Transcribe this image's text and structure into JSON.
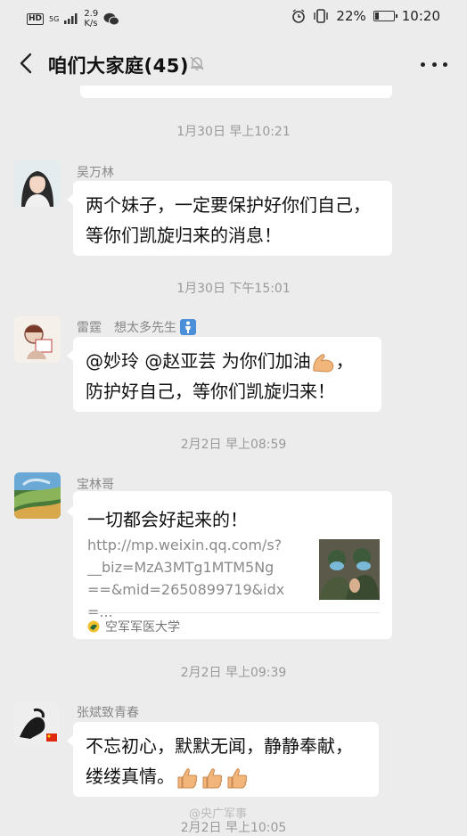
{
  "status_bar": {
    "hd": "HD",
    "network": "5G",
    "speed_value": "2.9",
    "speed_unit": "K/s",
    "battery": "22%",
    "battery_level": 0.22,
    "time": "10:20"
  },
  "nav": {
    "title": "咱们大家庭(45)"
  },
  "messages": [
    {
      "timestamp": "1月30日 早上10:21",
      "sender": "吴万林",
      "lines": [
        "两个妹子，一定要保护好你们自己，",
        "等你们凯旋归来的消息！"
      ]
    },
    {
      "timestamp": "1月30日 下午15:01",
      "sender": "雷霆　想太多先生",
      "lines": [
        "@妙玲 @赵亚芸 为你们加油",
        "，",
        "防护好自己，等你们凯旋归来！"
      ]
    },
    {
      "timestamp": "2月2日 早上08:59",
      "sender": "宝林哥",
      "card": {
        "title": "一切都会好起来的！",
        "desc_lines": [
          "http://mp.weixin.qq.com/s?",
          "__biz=MzA3MTg1MTM5Ng",
          "==&mid=2650899719&idx=..."
        ],
        "source": "空军军医大学"
      }
    },
    {
      "timestamp": "2月2日 早上09:39",
      "sender": "张斌致青春",
      "lines": [
        "不忘初心，默默无闻，静静奉献，",
        "缕缕真情。"
      ]
    },
    {
      "timestamp": "2月2日 早上10:05"
    }
  ],
  "watermark": "@央广军事"
}
